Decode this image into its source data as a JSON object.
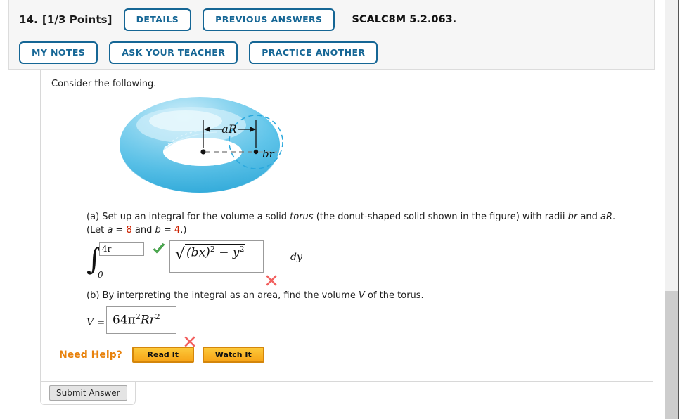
{
  "header": {
    "question_number": "14.",
    "points": "[1/3 Points]",
    "buttons_row1": [
      {
        "label": "DETAILS",
        "name": "details-button"
      },
      {
        "label": "PREVIOUS ANSWERS",
        "name": "previous-answers-button"
      }
    ],
    "question_code": "SCALC8M 5.2.063.",
    "buttons_row2": [
      {
        "label": "MY NOTES",
        "name": "my-notes-button"
      },
      {
        "label": "ASK YOUR TEACHER",
        "name": "ask-your-teacher-button"
      },
      {
        "label": "PRACTICE ANOTHER",
        "name": "practice-another-button"
      }
    ]
  },
  "content": {
    "consider": "Consider the following.",
    "figure": {
      "radius_major_label": "aR",
      "radius_minor_label": "br",
      "torus_color": "#5bc5ea",
      "torus_highlight": "#cdeefa",
      "circle_outline_color": "#2aa8dd"
    },
    "part_a": {
      "prompt_1": "(a) Set up an integral for the volume a solid ",
      "prompt_italic": "torus",
      "prompt_2": " (the donut-shaped solid shown in the figure) with radii ",
      "radii_1": "br",
      "prompt_3": " and ",
      "radii_2": "aR",
      "prompt_4": ".",
      "let_prefix": "(Let ",
      "let_a_var": "a",
      "let_a_eq": " = ",
      "let_a_val": "8",
      "let_and": " and ",
      "let_b_var": "b",
      "let_b_eq": " = ",
      "let_b_val": "4",
      "let_suffix": ".)",
      "integral_lower": "0",
      "integral_upper_value": "4r",
      "integral_upper_status": "correct",
      "expression_value": "√( (bx)² − y² )",
      "expr_radicand_open": "(",
      "expr_radicand_b": "b",
      "expr_radicand_x": "x",
      "expr_radicand_close": ")",
      "expr_exp_1": "2",
      "expr_minus": " − ",
      "expr_y": "y",
      "expr_exp_2": "2",
      "expression_status": "incorrect",
      "differential": "dy"
    },
    "part_b": {
      "prompt_1": "(b) By interpreting the integral as an area, find the volume ",
      "prompt_italic": "V",
      "prompt_2": " of the torus.",
      "v_label": "V =",
      "answer_value": "64π²Rr²",
      "answer_num": "64",
      "answer_pi": "π",
      "answer_pi_exp": "2",
      "answer_R": "R",
      "answer_r": "r",
      "answer_r_exp": "2",
      "answer_status": "incorrect"
    },
    "need_help": {
      "label": "Need Help?",
      "buttons": [
        {
          "label": "Read It",
          "name": "read-it-button"
        },
        {
          "label": "Watch It",
          "name": "watch-it-button"
        }
      ]
    },
    "submit": {
      "label": "Submit Answer"
    }
  },
  "status_icons": {
    "correct_color": "#4caf50",
    "incorrect_color": "#f2605f"
  }
}
